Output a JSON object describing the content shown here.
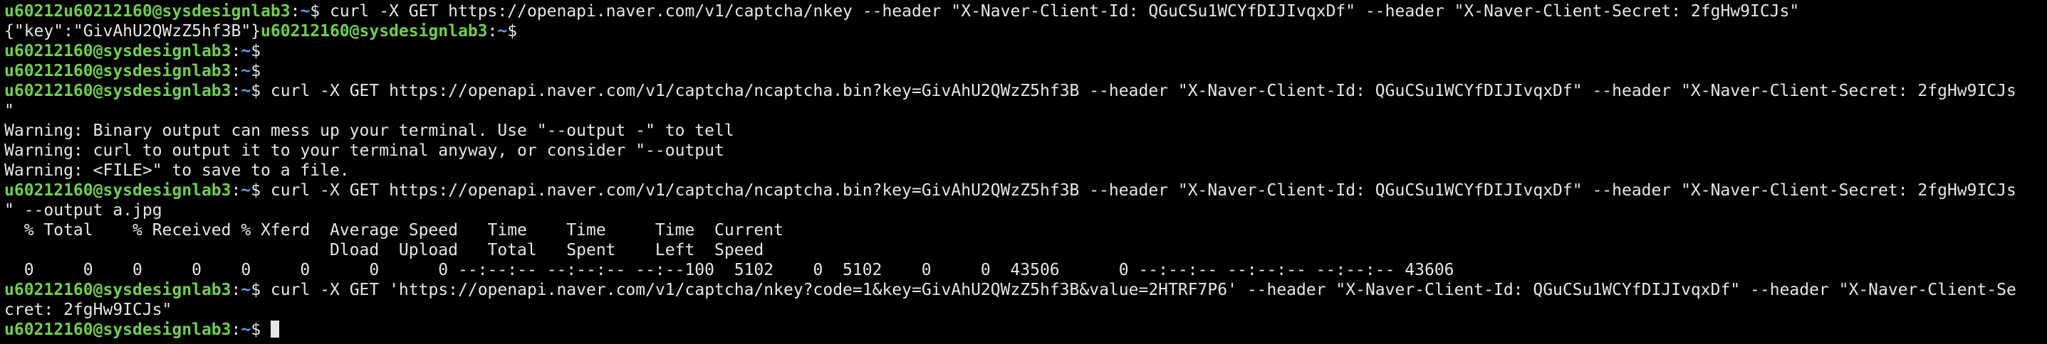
{
  "terminal": {
    "colors": {
      "prompt_user": "#6ed049",
      "prompt_path": "#5aa0ff",
      "text": "#e6e6e6",
      "background": "#000000"
    },
    "lines": [
      {
        "parts": [
          {
            "t": "u",
            "v": "u60212u60212160@sysdesignlab3"
          },
          {
            "t": "c",
            "v": ":"
          },
          {
            "t": "p",
            "v": "~"
          },
          {
            "t": "d",
            "v": "$ "
          },
          {
            "t": "x",
            "v": "curl -X GET https://openapi.naver.com/v1/captcha/nkey --header \"X-Naver-Client-Id: QGuCSu1WCYfDIJIvqxDf\" --header \"X-Naver-Client-Secret: 2fgHw9ICJs\""
          }
        ]
      },
      {
        "parts": [
          {
            "t": "x",
            "v": "{\"key\":\"GivAhU2QWzZ5hf3B\"}"
          },
          {
            "t": "u",
            "v": "u60212160@sysdesignlab3"
          },
          {
            "t": "c",
            "v": ":"
          },
          {
            "t": "p",
            "v": "~"
          },
          {
            "t": "d",
            "v": "$"
          }
        ]
      },
      {
        "parts": [
          {
            "t": "u",
            "v": "u60212160@sysdesignlab3"
          },
          {
            "t": "c",
            "v": ":"
          },
          {
            "t": "p",
            "v": "~"
          },
          {
            "t": "d",
            "v": "$"
          }
        ]
      },
      {
        "parts": [
          {
            "t": "u",
            "v": "u60212160@sysdesignlab3"
          },
          {
            "t": "c",
            "v": ":"
          },
          {
            "t": "p",
            "v": "~"
          },
          {
            "t": "d",
            "v": "$"
          }
        ]
      },
      {
        "parts": [
          {
            "t": "u",
            "v": "u60212160@sysdesignlab3"
          },
          {
            "t": "c",
            "v": ":"
          },
          {
            "t": "p",
            "v": "~"
          },
          {
            "t": "d",
            "v": "$ "
          },
          {
            "t": "x",
            "v": "curl -X GET https://openapi.naver.com/v1/captcha/ncaptcha.bin?key=GivAhU2QWzZ5hf3B --header \"X-Naver-Client-Id: QGuCSu1WCYfDIJIvqxDf\" --header \"X-Naver-Client-Secret: 2fgHw9ICJs"
          }
        ]
      },
      {
        "parts": [
          {
            "t": "x",
            "v": "\""
          }
        ]
      },
      {
        "parts": [
          {
            "t": "x",
            "v": "Warning: Binary output can mess up your terminal. Use \"--output -\" to tell"
          }
        ]
      },
      {
        "parts": [
          {
            "t": "x",
            "v": "Warning: curl to output it to your terminal anyway, or consider \"--output"
          }
        ]
      },
      {
        "parts": [
          {
            "t": "x",
            "v": "Warning: <FILE>\" to save to a file."
          }
        ]
      },
      {
        "parts": [
          {
            "t": "u",
            "v": "u60212160@sysdesignlab3"
          },
          {
            "t": "c",
            "v": ":"
          },
          {
            "t": "p",
            "v": "~"
          },
          {
            "t": "d",
            "v": "$ "
          },
          {
            "t": "x",
            "v": "curl -X GET https://openapi.naver.com/v1/captcha/ncaptcha.bin?key=GivAhU2QWzZ5hf3B --header \"X-Naver-Client-Id: QGuCSu1WCYfDIJIvqxDf\" --header \"X-Naver-Client-Secret: 2fgHw9ICJs"
          }
        ]
      },
      {
        "parts": [
          {
            "t": "x",
            "v": "\" --output a.jpg"
          }
        ]
      },
      {
        "parts": [
          {
            "t": "x",
            "v": "  % Total    % Received % Xferd  Average Speed   Time    Time     Time  Current"
          }
        ]
      },
      {
        "parts": [
          {
            "t": "x",
            "v": "                                 Dload  Upload   Total   Spent    Left  Speed"
          }
        ]
      },
      {
        "parts": [
          {
            "t": "x",
            "v": "  0     0    0     0    0     0      0      0 --:--:-- --:--:-- --:--100  5102    0  5102    0     0  43506      0 --:--:-- --:--:-- --:--:-- 43606"
          }
        ]
      },
      {
        "parts": [
          {
            "t": "u",
            "v": "u60212160@sysdesignlab3"
          },
          {
            "t": "c",
            "v": ":"
          },
          {
            "t": "p",
            "v": "~"
          },
          {
            "t": "d",
            "v": "$ "
          },
          {
            "t": "x",
            "v": "curl -X GET 'https://openapi.naver.com/v1/captcha/nkey?code=1&key=GivAhU2QWzZ5hf3B&value=2HTRF7P6' --header \"X-Naver-Client-Id: QGuCSu1WCYfDIJIvqxDf\" --header \"X-Naver-Client-Se"
          }
        ]
      },
      {
        "parts": [
          {
            "t": "x",
            "v": "cret: 2fgHw9ICJs\""
          }
        ]
      },
      {
        "parts": [
          {
            "t": "u",
            "v": "u60212160@sysdesignlab3"
          },
          {
            "t": "c",
            "v": ":"
          },
          {
            "t": "p",
            "v": "~"
          },
          {
            "t": "d",
            "v": "$ "
          },
          {
            "t": "cur",
            "v": ""
          }
        ]
      }
    ]
  }
}
